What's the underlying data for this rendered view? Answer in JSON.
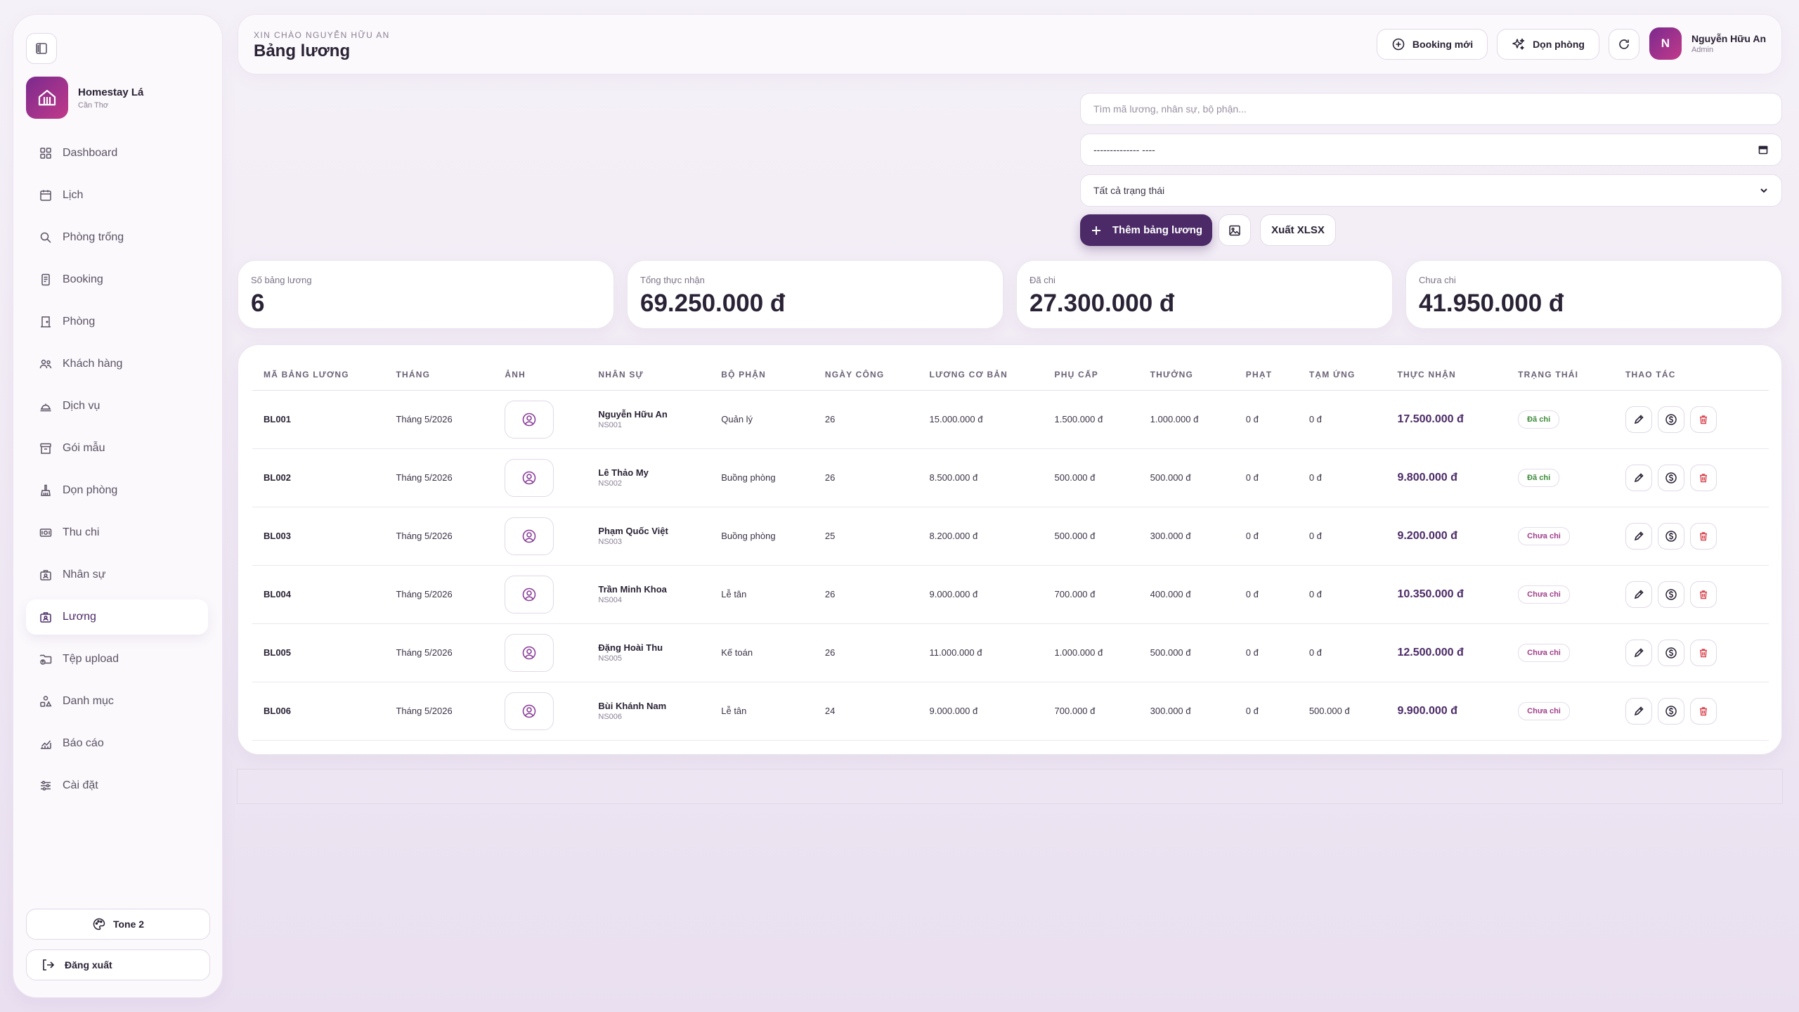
{
  "brand": {
    "name": "Homestay Lá",
    "location": "Cần Thơ"
  },
  "nav": [
    {
      "label": "Dashboard",
      "icon": "dashboard-icon"
    },
    {
      "label": "Lịch",
      "icon": "calendar-icon"
    },
    {
      "label": "Phòng trống",
      "icon": "search-icon"
    },
    {
      "label": "Booking",
      "icon": "booking-icon"
    },
    {
      "label": "Phòng",
      "icon": "door-icon"
    },
    {
      "label": "Khách hàng",
      "icon": "users-icon"
    },
    {
      "label": "Dịch vụ",
      "icon": "service-icon"
    },
    {
      "label": "Gói mẫu",
      "icon": "archive-icon"
    },
    {
      "label": "Dọn phòng",
      "icon": "cleaning-icon"
    },
    {
      "label": "Thu chi",
      "icon": "money-icon"
    },
    {
      "label": "Nhân sự",
      "icon": "staff-icon"
    },
    {
      "label": "Lương",
      "icon": "payroll-icon"
    },
    {
      "label": "Tệp upload",
      "icon": "upload-folder-icon"
    },
    {
      "label": "Danh mục",
      "icon": "category-icon"
    },
    {
      "label": "Báo cáo",
      "icon": "report-icon"
    },
    {
      "label": "Cài đặt",
      "icon": "settings-icon"
    }
  ],
  "active_nav": "Lương",
  "sidebar_footer": {
    "theme_label": "Tone 2",
    "logout_label": "Đăng xuất"
  },
  "header": {
    "greeting": "XIN CHÀO NGUYỄN HỮU AN",
    "title": "Bảng lương",
    "new_booking_label": "Booking mới",
    "cleaning_label": "Dọn phòng",
    "user_initial": "N",
    "user_name": "Nguyễn Hữu An",
    "user_role": "Admin"
  },
  "filters": {
    "search_placeholder": "Tìm mã lương, nhân sự, bộ phận...",
    "month_value": "-------------- ----",
    "status_value": "Tất cả trạng thái"
  },
  "actions": {
    "add_label": "Thêm bảng lương",
    "export_label": "Xuất XLSX"
  },
  "stats": [
    {
      "label": "Số bảng lương",
      "value": "6"
    },
    {
      "label": "Tổng thực nhận",
      "value": "69.250.000 đ"
    },
    {
      "label": "Đã chi",
      "value": "27.300.000 đ"
    },
    {
      "label": "Chưa chi",
      "value": "41.950.000 đ"
    }
  ],
  "table": {
    "columns": [
      "MÃ BẢNG LƯƠNG",
      "THÁNG",
      "ẢNH",
      "NHÂN SỰ",
      "BỘ PHẬN",
      "NGÀY CÔNG",
      "LƯƠNG CƠ BẢN",
      "PHỤ CẤP",
      "THƯỞNG",
      "PHẠT",
      "TẠM ỨNG",
      "THỰC NHẬN",
      "TRẠNG THÁI",
      "THAO TÁC"
    ],
    "rows": [
      {
        "code": "BL001",
        "month": "Tháng 5/2026",
        "name": "Nguyễn Hữu An",
        "emp_id": "NS001",
        "dept": "Quản lý",
        "days": "26",
        "base": "15.000.000 đ",
        "allowance": "1.500.000 đ",
        "bonus": "1.000.000 đ",
        "penalty": "0 đ",
        "advance": "0 đ",
        "net": "17.500.000 đ",
        "status": "Đã chi",
        "paid": true
      },
      {
        "code": "BL002",
        "month": "Tháng 5/2026",
        "name": "Lê Thảo My",
        "emp_id": "NS002",
        "dept": "Buồng phòng",
        "days": "26",
        "base": "8.500.000 đ",
        "allowance": "500.000 đ",
        "bonus": "500.000 đ",
        "penalty": "0 đ",
        "advance": "0 đ",
        "net": "9.800.000 đ",
        "status": "Đã chi",
        "paid": true
      },
      {
        "code": "BL003",
        "month": "Tháng 5/2026",
        "name": "Phạm Quốc Việt",
        "emp_id": "NS003",
        "dept": "Buồng phòng",
        "days": "25",
        "base": "8.200.000 đ",
        "allowance": "500.000 đ",
        "bonus": "300.000 đ",
        "penalty": "0 đ",
        "advance": "0 đ",
        "net": "9.200.000 đ",
        "status": "Chưa chi",
        "paid": false
      },
      {
        "code": "BL004",
        "month": "Tháng 5/2026",
        "name": "Trần Minh Khoa",
        "emp_id": "NS004",
        "dept": "Lễ tân",
        "days": "26",
        "base": "9.000.000 đ",
        "allowance": "700.000 đ",
        "bonus": "400.000 đ",
        "penalty": "0 đ",
        "advance": "0 đ",
        "net": "10.350.000 đ",
        "status": "Chưa chi",
        "paid": false
      },
      {
        "code": "BL005",
        "month": "Tháng 5/2026",
        "name": "Đặng Hoài Thu",
        "emp_id": "NS005",
        "dept": "Kế toán",
        "days": "26",
        "base": "11.000.000 đ",
        "allowance": "1.000.000 đ",
        "bonus": "500.000 đ",
        "penalty": "0 đ",
        "advance": "0 đ",
        "net": "12.500.000 đ",
        "status": "Chưa chi",
        "paid": false
      },
      {
        "code": "BL006",
        "month": "Tháng 5/2026",
        "name": "Bùi Khánh Nam",
        "emp_id": "NS006",
        "dept": "Lễ tân",
        "days": "24",
        "base": "9.000.000 đ",
        "allowance": "700.000 đ",
        "bonus": "300.000 đ",
        "penalty": "0 đ",
        "advance": "500.000 đ",
        "net": "9.900.000 đ",
        "status": "Chưa chi",
        "paid": false
      }
    ]
  },
  "colors": {
    "primary": "#4b2a67",
    "brand_gradient_start": "#7b2a8e",
    "brand_gradient_end": "#c13a8a",
    "paid": "#3e8a3a",
    "unpaid": "#a0408c",
    "delete": "#d9434e"
  }
}
